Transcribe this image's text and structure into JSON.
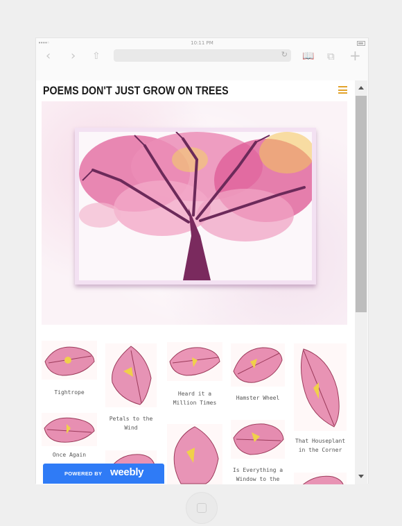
{
  "status": {
    "signal": "••••◦",
    "time": "10:11 PM"
  },
  "toolbar": {
    "back_icon": "chevron-left-icon",
    "forward_icon": "chevron-right-icon",
    "share_icon": "share-icon",
    "reload_icon": "reload-icon",
    "bookmarks_icon": "book-icon",
    "tabs_icon": "tabs-icon",
    "add_icon": "plus-icon",
    "url": ""
  },
  "site": {
    "title": "POEMS DON'T JUST GROW ON TREES",
    "accent": "#e2a32b"
  },
  "gallery": {
    "items": [
      {
        "caption": "Tightrope"
      },
      {
        "caption": "Petals to the Wind"
      },
      {
        "caption": "Heard it a Million Times"
      },
      {
        "caption": "Hamster Wheel"
      },
      {
        "caption": "That Houseplant in the Corner"
      },
      {
        "caption": "Once Again"
      },
      {
        "caption": ""
      },
      {
        "caption": ""
      },
      {
        "caption": "Is Everything a Window to the"
      },
      {
        "caption": ""
      }
    ]
  },
  "badge": {
    "powered": "POWERED BY",
    "brand": "weebly",
    "color": "#2f7bf6"
  }
}
